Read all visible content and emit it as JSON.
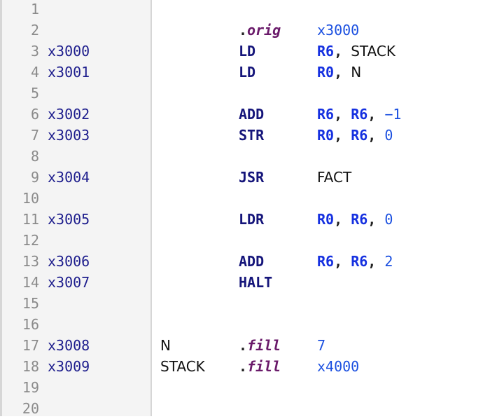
{
  "lines": [
    {
      "n": "1"
    },
    {
      "n": "2",
      "op": "orig",
      "directive": true,
      "args": [
        {
          "t": "x3000",
          "k": "num"
        }
      ]
    },
    {
      "n": "3",
      "addr": "x3000",
      "op": "LD",
      "args": [
        {
          "t": "R6",
          "k": "reg"
        },
        {
          "t": ", ",
          "k": "punct"
        },
        {
          "t": "STACK",
          "k": "sym"
        }
      ]
    },
    {
      "n": "4",
      "addr": "x3001",
      "op": "LD",
      "args": [
        {
          "t": "R0",
          "k": "reg"
        },
        {
          "t": ", ",
          "k": "punct"
        },
        {
          "t": "N",
          "k": "sym"
        }
      ]
    },
    {
      "n": "5"
    },
    {
      "n": "6",
      "addr": "x3002",
      "op": "ADD",
      "args": [
        {
          "t": "R6",
          "k": "reg"
        },
        {
          "t": ", ",
          "k": "punct"
        },
        {
          "t": "R6",
          "k": "reg"
        },
        {
          "t": ", ",
          "k": "punct"
        },
        {
          "t": "−1",
          "k": "num"
        }
      ]
    },
    {
      "n": "7",
      "addr": "x3003",
      "op": "STR",
      "args": [
        {
          "t": "R0",
          "k": "reg"
        },
        {
          "t": ", ",
          "k": "punct"
        },
        {
          "t": "R6",
          "k": "reg"
        },
        {
          "t": ", ",
          "k": "punct"
        },
        {
          "t": "0",
          "k": "num"
        }
      ]
    },
    {
      "n": "8"
    },
    {
      "n": "9",
      "addr": "x3004",
      "op": "JSR",
      "args": [
        {
          "t": "FACT",
          "k": "sym"
        }
      ]
    },
    {
      "n": "10"
    },
    {
      "n": "11",
      "addr": "x3005",
      "op": "LDR",
      "args": [
        {
          "t": "R0",
          "k": "reg"
        },
        {
          "t": ", ",
          "k": "punct"
        },
        {
          "t": "R6",
          "k": "reg"
        },
        {
          "t": ", ",
          "k": "punct"
        },
        {
          "t": "0",
          "k": "num"
        }
      ]
    },
    {
      "n": "12"
    },
    {
      "n": "13",
      "addr": "x3006",
      "op": "ADD",
      "args": [
        {
          "t": "R6",
          "k": "reg"
        },
        {
          "t": ", ",
          "k": "punct"
        },
        {
          "t": "R6",
          "k": "reg"
        },
        {
          "t": ", ",
          "k": "punct"
        },
        {
          "t": "2",
          "k": "num"
        }
      ]
    },
    {
      "n": "14",
      "addr": "x3007",
      "op": "HALT"
    },
    {
      "n": "15"
    },
    {
      "n": "16"
    },
    {
      "n": "17",
      "addr": "x3008",
      "label": "N",
      "op": "fill",
      "directive": true,
      "args": [
        {
          "t": "7",
          "k": "num"
        }
      ]
    },
    {
      "n": "18",
      "addr": "x3009",
      "label": "STACK",
      "op": "fill",
      "directive": true,
      "args": [
        {
          "t": "x4000",
          "k": "num"
        }
      ]
    },
    {
      "n": "19"
    },
    {
      "n": "20"
    }
  ],
  "colors": {
    "gutter_bg": "#f4f4f4",
    "line_number": "#8a8a8a",
    "address": "#1c1c8c",
    "opcode": "#15157a",
    "directive": "#6a1a6a",
    "register": "#1530e0",
    "number": "#1a4fe0"
  }
}
